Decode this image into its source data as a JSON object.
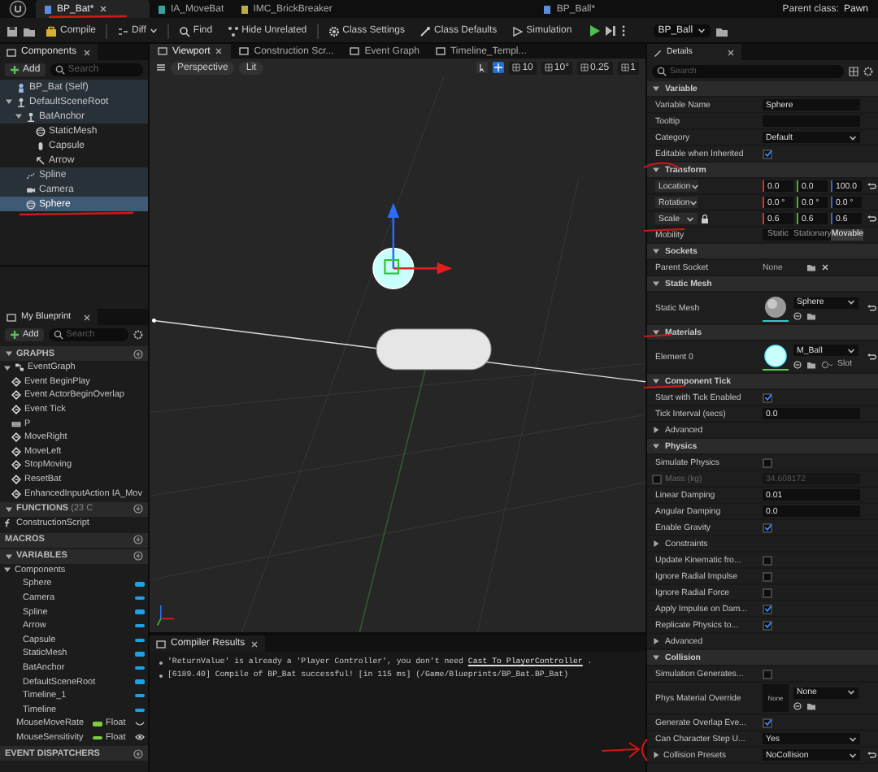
{
  "editor_tabs": [
    {
      "label": "BP_Bat*",
      "selected": true
    },
    {
      "label": "IA_MoveBat",
      "selected": false
    },
    {
      "label": "IMC_BrickBreaker",
      "selected": false
    },
    {
      "label": "BP_Ball*",
      "selected": false
    }
  ],
  "parent_class": {
    "label": "Parent class:",
    "value": "Pawn"
  },
  "toolbar": {
    "buttons": [
      {
        "label": "Compile",
        "kind": "compile"
      },
      {
        "label": "Diff",
        "kind": "diff"
      },
      {
        "label": "Find",
        "kind": "find"
      },
      {
        "label": "Hide Unrelated",
        "kind": "filter"
      },
      {
        "label": "Class Settings",
        "kind": "settings"
      },
      {
        "label": "Class Defaults",
        "kind": "defaults"
      },
      {
        "label": "Simulation",
        "kind": "simulate"
      }
    ],
    "debug_object": "BP_Ball"
  },
  "components": {
    "title": "Components",
    "add": "Add",
    "search_placeholder": "Search",
    "tree": [
      {
        "label": "BP_Bat (Self)",
        "kind": "actor",
        "selected": false
      },
      {
        "label": "DefaultSceneRoot",
        "kind": "scene",
        "selected": false,
        "expanded": true,
        "children": [
          {
            "label": "BatAnchor",
            "kind": "scene",
            "selected": false,
            "expanded": true,
            "children": [
              {
                "label": "StaticMesh",
                "kind": "mesh",
                "selected": false
              },
              {
                "label": "Capsule",
                "kind": "capsule",
                "selected": false
              },
              {
                "label": "Arrow",
                "kind": "arrow",
                "selected": false
              }
            ]
          },
          {
            "label": "Spline",
            "kind": "spline",
            "selected": false
          },
          {
            "label": "Camera",
            "kind": "camera",
            "selected": false
          },
          {
            "label": "Sphere",
            "kind": "mesh",
            "selected": true
          }
        ]
      }
    ]
  },
  "my_blueprint": {
    "title": "My Blueprint",
    "add": "Add",
    "search_placeholder": "Search",
    "sections": [
      {
        "label": "GRAPHS",
        "expanded": true,
        "items": [
          {
            "label": "EventGraph",
            "kind": "graph",
            "expanded": true,
            "children": [
              {
                "label": "Event BeginPlay",
                "kind": "event"
              },
              {
                "label": "Event ActorBeginOverlap",
                "kind": "event"
              },
              {
                "label": "Event Tick",
                "kind": "event"
              },
              {
                "label": "P",
                "kind": "key"
              },
              {
                "label": "MoveRight",
                "kind": "event"
              },
              {
                "label": "MoveLeft",
                "kind": "event"
              },
              {
                "label": "StopMoving",
                "kind": "event"
              },
              {
                "label": "ResetBat",
                "kind": "event"
              },
              {
                "label": "EnhancedInputAction IA_Mov",
                "kind": "event"
              }
            ]
          }
        ]
      },
      {
        "label": "FUNCTIONS",
        "count": "(23 C",
        "expanded": true,
        "items": [
          {
            "label": "ConstructionScript",
            "kind": "function"
          }
        ]
      },
      {
        "label": "MACROS"
      },
      {
        "label": "VARIABLES",
        "expanded": true,
        "items": [
          {
            "label": "Components",
            "kind": "category",
            "expanded": true,
            "children": [
              {
                "label": "Sphere",
                "kind": "component"
              },
              {
                "label": "Camera",
                "kind": "component"
              },
              {
                "label": "Spline",
                "kind": "component"
              },
              {
                "label": "Arrow",
                "kind": "component"
              },
              {
                "label": "Capsule",
                "kind": "component"
              },
              {
                "label": "StaticMesh",
                "kind": "component"
              },
              {
                "label": "BatAnchor",
                "kind": "component"
              },
              {
                "label": "DefaultSceneRoot",
                "kind": "component"
              },
              {
                "label": "Timeline_1",
                "kind": "component"
              },
              {
                "label": "Timeline",
                "kind": "component"
              }
            ]
          },
          {
            "label": "MouseMoveRate",
            "kind": "float",
            "type": "Float",
            "exposed": false
          },
          {
            "label": "MouseSensitivity",
            "kind": "float",
            "type": "Float",
            "exposed": true
          }
        ]
      },
      {
        "label": "EVENT DISPATCHERS"
      }
    ]
  },
  "viewport": {
    "tabs": [
      {
        "label": "Viewport",
        "selected": true
      },
      {
        "label": "Construction Scr...",
        "selected": false
      },
      {
        "label": "Event Graph",
        "selected": false
      },
      {
        "label": "Timeline_Templ...",
        "selected": false
      }
    ],
    "view": "Perspective",
    "lighting": "Lit",
    "snaps": [
      "10",
      "10°",
      "0.25",
      "1"
    ]
  },
  "compiler": {
    "tab": "Compiler Results",
    "messages": [
      {
        "text": "'ReturnValue' is already a 'Player Controller', you don't need",
        "link": "Cast To PlayerController",
        "after": "."
      },
      {
        "text": "[6189.40] Compile of BP_Bat successful! [in 115 ms] (/Game/Blueprints/BP_Bat.BP_Bat)"
      }
    ]
  },
  "details": {
    "tab": "Details",
    "search_placeholder": "Search",
    "rows": [
      {
        "kind": "section",
        "label": "Variable",
        "expanded": true
      },
      {
        "kind": "text",
        "label": "Variable Name",
        "value": "Sphere"
      },
      {
        "kind": "text",
        "label": "Tooltip"
      },
      {
        "kind": "dropdown",
        "label": "Category",
        "value": "Default"
      },
      {
        "kind": "check",
        "label": "Editable when Inherited",
        "checked": true
      },
      {
        "kind": "section",
        "label": "Transform",
        "expanded": true
      },
      {
        "kind": "vector",
        "label": "Location",
        "values": [
          "0.0",
          "0.0",
          "100.0"
        ],
        "reset": true
      },
      {
        "kind": "vector",
        "label": "Rotation",
        "values": [
          "0.0 °",
          "0.0 °",
          "0.0 °"
        ],
        "reset": false
      },
      {
        "kind": "vector",
        "label": "Scale",
        "values": [
          "0.6",
          "0.6",
          "0.6"
        ],
        "reset": true,
        "locked": true
      },
      {
        "kind": "segmented",
        "label": "Mobility",
        "options": [
          {
            "label": "Static",
            "selected": false
          },
          {
            "label": "Stationary",
            "selected": false
          },
          {
            "label": "Movable",
            "selected": true
          }
        ]
      },
      {
        "kind": "section",
        "label": "Sockets",
        "expanded": true
      },
      {
        "kind": "socket",
        "label": "Parent Socket",
        "value": "None"
      },
      {
        "kind": "section",
        "label": "Static Mesh",
        "expanded": true
      },
      {
        "kind": "asset",
        "label": "Static Mesh",
        "value": "Sphere",
        "thumbnail": {
          "kind": "mesh"
        },
        "reset": true
      },
      {
        "kind": "section",
        "label": "Materials",
        "expanded": true
      },
      {
        "kind": "asset",
        "label": "Element 0",
        "value": "M_Ball",
        "thumbnail": {
          "kind": "glow"
        },
        "slot": "Slot",
        "reset": true
      },
      {
        "kind": "section",
        "label": "Component Tick",
        "expanded": true
      },
      {
        "kind": "check",
        "label": "Start with Tick Enabled",
        "checked": true
      },
      {
        "kind": "text",
        "label": "Tick Interval (secs)",
        "value": "0.0"
      },
      {
        "kind": "group",
        "label": "Advanced",
        "expanded": false
      },
      {
        "kind": "section",
        "label": "Physics",
        "expanded": true
      },
      {
        "kind": "check",
        "label": "Simulate Physics",
        "checked": false
      },
      {
        "kind": "mass",
        "label": "Mass (kg)",
        "checked": false,
        "value": "34.608172"
      },
      {
        "kind": "text",
        "label": "Linear Damping",
        "value": "0.01"
      },
      {
        "kind": "text",
        "label": "Angular Damping",
        "value": "0.0"
      },
      {
        "kind": "check",
        "label": "Enable Gravity",
        "checked": true
      },
      {
        "kind": "group",
        "label": "Constraints",
        "expanded": false
      },
      {
        "kind": "check",
        "label": "Update Kinematic fro...",
        "checked": false
      },
      {
        "kind": "check",
        "label": "Ignore Radial Impulse",
        "checked": false
      },
      {
        "kind": "check",
        "label": "Ignore Radial Force",
        "checked": false
      },
      {
        "kind": "check",
        "label": "Apply Impulse on Dam...",
        "checked": true
      },
      {
        "kind": "check",
        "label": "Replicate Physics to...",
        "checked": true
      },
      {
        "kind": "group",
        "label": "Advanced",
        "expanded": false
      },
      {
        "kind": "section",
        "label": "Collision",
        "expanded": true
      },
      {
        "kind": "check",
        "label": "Simulation Generates...",
        "checked": false
      },
      {
        "kind": "asset",
        "label": "Phys Material Override",
        "value": "None",
        "thumbnail": {
          "kind": "empty",
          "text": "None"
        },
        "reset": false
      },
      {
        "kind": "check",
        "label": "Generate Overlap Eve...",
        "checked": true
      },
      {
        "kind": "dropdown",
        "label": "Can Character Step U...",
        "value": "Yes"
      },
      {
        "kind": "dropdown",
        "label": "Collision Presets",
        "value": "NoCollision",
        "expanded": false,
        "reset": true
      }
    ]
  }
}
